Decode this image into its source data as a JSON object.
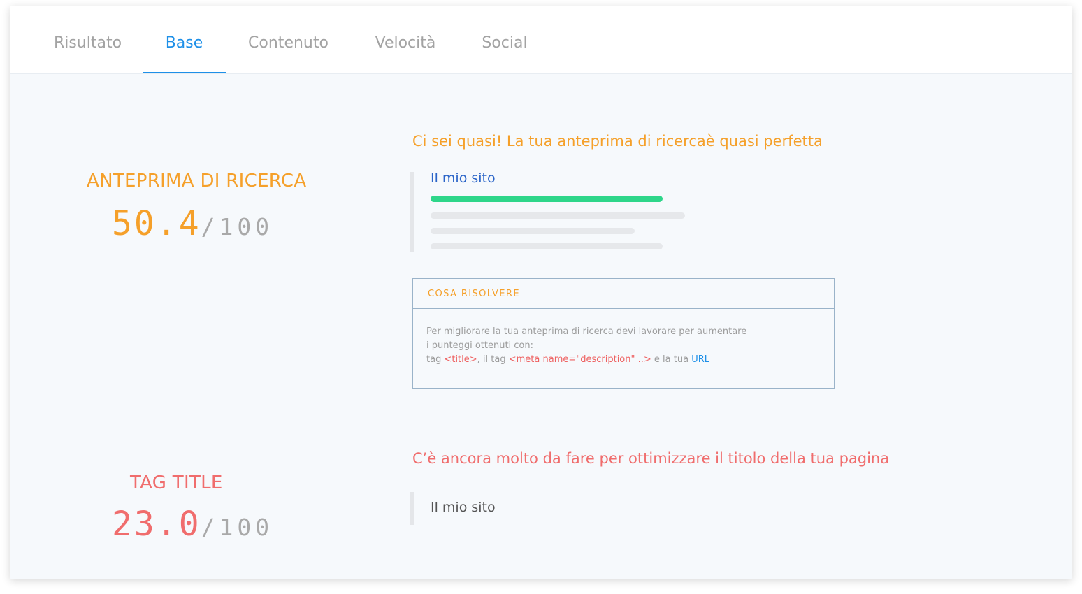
{
  "tabs": [
    {
      "label": "Risultato",
      "active": false
    },
    {
      "label": "Base",
      "active": true
    },
    {
      "label": "Contenuto",
      "active": false
    },
    {
      "label": "Velocità",
      "active": false
    },
    {
      "label": "Social",
      "active": false
    }
  ],
  "colors": {
    "accent": "#1e90e8",
    "warning": "#f5a02a",
    "danger": "#f06d6d",
    "success": "#2ed68a"
  },
  "sections": [
    {
      "label": "ANTEPRIMA DI RICERCA",
      "score": "50.4",
      "max": "/100",
      "status": "warning",
      "headline": "Ci sei quasi! La tua anteprima di ricercaè quasi perfetta",
      "preview_title": "Il mio sito",
      "fix": {
        "title": "COSA RISOLVERE",
        "line1": "Per migliorare la tua anteprima di ricerca devi lavorare per aumentare",
        "line2": "i punteggi ottenuti con:",
        "line3_prefix": "tag ",
        "title_tag": "<title>",
        "line3_mid": ", il tag ",
        "meta_tag": "<meta name=\"description\" ..>",
        "line3_suffix": " e la tua ",
        "url_link": "URL"
      }
    },
    {
      "label": "TAG TITLE",
      "score": "23.0",
      "max": "/100",
      "status": "danger",
      "headline": "C’è ancora molto da fare per ottimizzare il titolo della tua pagina",
      "preview_title": "Il mio sito"
    }
  ]
}
